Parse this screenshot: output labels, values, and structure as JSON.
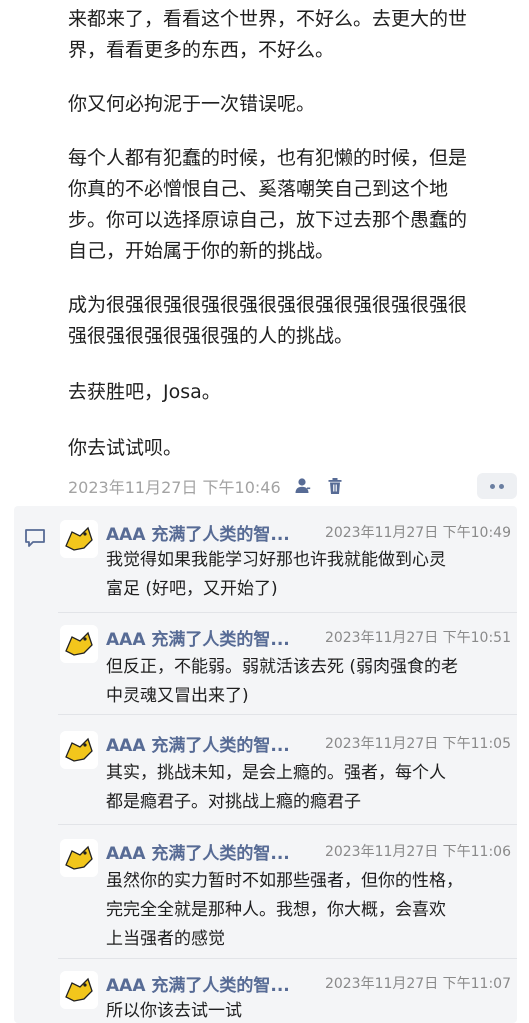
{
  "post": {
    "paragraphs": [
      "来都来了，看看这个世界，不好么。去更大的世\n界，看看更多的东西，不好么。",
      "你又何必拘泥于一次错误呢。",
      "每个人都有犯蠢的时候，也有犯懒的时候，但是\n你真的不必憎恨自己、奚落嘲笑自己到这个地\n步。你可以选择原谅自己，放下过去那个愚蠢的\n自己，开始属于你的新的挑战。",
      "成为很强很强很强很强很强很强很强很强很强很\n强很强很强很强很强的人的挑战。",
      "去获胜吧，Josa。",
      "你去试试呗。"
    ],
    "timestamp": "2023年11月27日 下午10:46",
    "icons": {
      "visibility": "person-icon",
      "delete": "trash-icon",
      "more": "more-dots-icon"
    },
    "accent_color": "#576b95"
  },
  "comments": {
    "icon": "comment-bubble-icon",
    "items": [
      {
        "author": "AAA 充满了人类的智...",
        "time": "2023年11月27日 下午10:49",
        "text": "我觉得如果我能学习好那也许我就能做到心灵\n富足 (好吧，又开始了)"
      },
      {
        "author": "AAA 充满了人类的智...",
        "time": "2023年11月27日 下午10:51",
        "text": "但反正，不能弱。弱就活该去死 (弱肉强食的老\n中灵魂又冒出来了)"
      },
      {
        "author": "AAA 充满了人类的智...",
        "time": "2023年11月27日 下午11:05",
        "text": "其实，挑战未知，是会上瘾的。强者，每个人\n都是瘾君子。对挑战上瘾的瘾君子"
      },
      {
        "author": "AAA 充满了人类的智...",
        "time": "2023年11月27日 下午11:06",
        "text": "虽然你的实力暂时不如那些强者，但你的性格，\n完完全全就是那种人。我想，你大概，会喜欢\n上当强者的感觉"
      },
      {
        "author": "AAA 充满了人类的智...",
        "time": "2023年11月27日 下午11:07",
        "text": "所以你该去试一试"
      }
    ]
  }
}
